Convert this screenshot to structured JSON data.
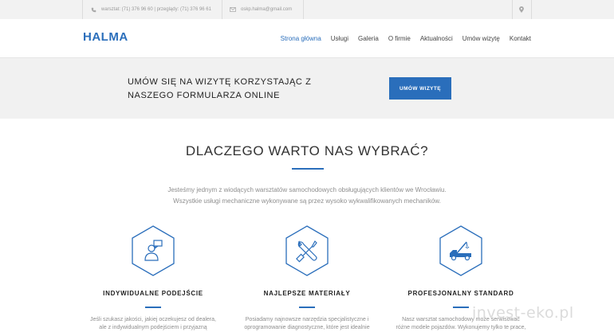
{
  "topbar": {
    "phone_text": "warsztat: (71) 376 96 60 | przeglądy: (71) 376 96 61",
    "email_text": "oskp.halma@gmail.com"
  },
  "header": {
    "logo": "HALMA",
    "nav": [
      {
        "label": "Strona główna",
        "active": true
      },
      {
        "label": "Usługi",
        "active": false
      },
      {
        "label": "Galeria",
        "active": false
      },
      {
        "label": "O firmie",
        "active": false
      },
      {
        "label": "Aktualności",
        "active": false
      },
      {
        "label": "Umów wizytę",
        "active": false
      },
      {
        "label": "Kontakt",
        "active": false
      }
    ]
  },
  "cta": {
    "text": "UMÓW SIĘ NA WIZYTĘ KORZYSTAJĄC Z NASZEGO FORMULARZA ONLINE",
    "button_label": "UMÓW WIZYTĘ"
  },
  "why": {
    "title": "DLACZEGO WARTO NAS WYBRAĆ?",
    "intro_line1": "Jesteśmy jednym z wiodących warsztatów samochodowych obsługujących klientów we Wrocławiu.",
    "intro_line2": "Wszystkie usługi mechaniczne wykonywane są przez wysoko wykwalifikowanych mechaników."
  },
  "features": [
    {
      "icon": "person-chat-icon",
      "title": "INDYWIDUALNE PODEJŚCIE",
      "text_line1": "Jeśli szukasz jakości, jakiej oczekujesz od dealera,",
      "text_line2": "ale z indywidualnym podejściem i przyjazną"
    },
    {
      "icon": "wrench-screwdriver-icon",
      "title": "NAJLEPSZE MATERIAŁY",
      "text_line1": "Posiadamy najnowsze narzędzia specjalistyczne i",
      "text_line2": "oprogramowanie diagnostyczne, które jest idealnie"
    },
    {
      "icon": "tow-truck-icon",
      "title": "PROFESJONALNY STANDARD",
      "text_line1": "Nasz warsztat samochodowy może serwisować",
      "text_line2": "różne modele pojazdów. Wykonujemy tylko te prace,"
    }
  ],
  "watermark": "invest-eko.pl",
  "colors": {
    "accent": "#2a6ebb",
    "cta_bg": "#f1f1f1",
    "topbar_bg": "#f2f2f2"
  }
}
